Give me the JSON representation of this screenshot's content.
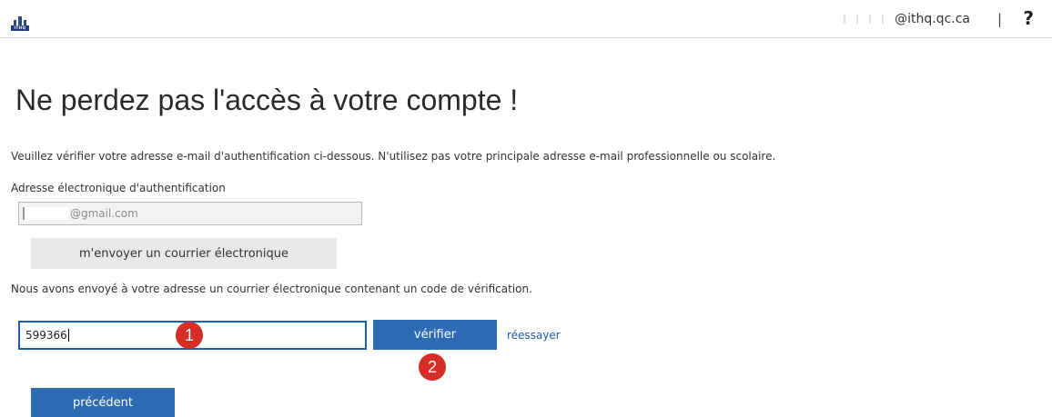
{
  "header": {
    "logo_text": "ITHQ",
    "user_email_domain": "@ithq.qc.ca",
    "separator": "|",
    "help_label": "?"
  },
  "main": {
    "title": "Ne perdez pas l'accès à votre compte !",
    "instructions": "Veuillez vérifier votre adresse e-mail d'authentification ci-dessous. N'utilisez pas votre principale adresse e-mail professionnelle ou scolaire.",
    "email_field_label": "Adresse électronique d'authentification",
    "email_value_visible": "@gmail.com",
    "send_button_label": "m'envoyer un courrier électronique",
    "sent_message": "Nous avons envoyé à votre adresse un courrier électronique contenant un code de vérification.",
    "code_value": "599366",
    "verify_button_label": "vérifier",
    "retry_link_label": "réessayer",
    "previous_button_label": "précédent"
  },
  "annotations": {
    "badge_1": "1",
    "badge_2": "2"
  },
  "colors": {
    "primary_button": "#2d6cb5",
    "link": "#1a5fa5",
    "annotation_badge": "#d42e27",
    "input_focus_border": "#1a5fb4"
  }
}
